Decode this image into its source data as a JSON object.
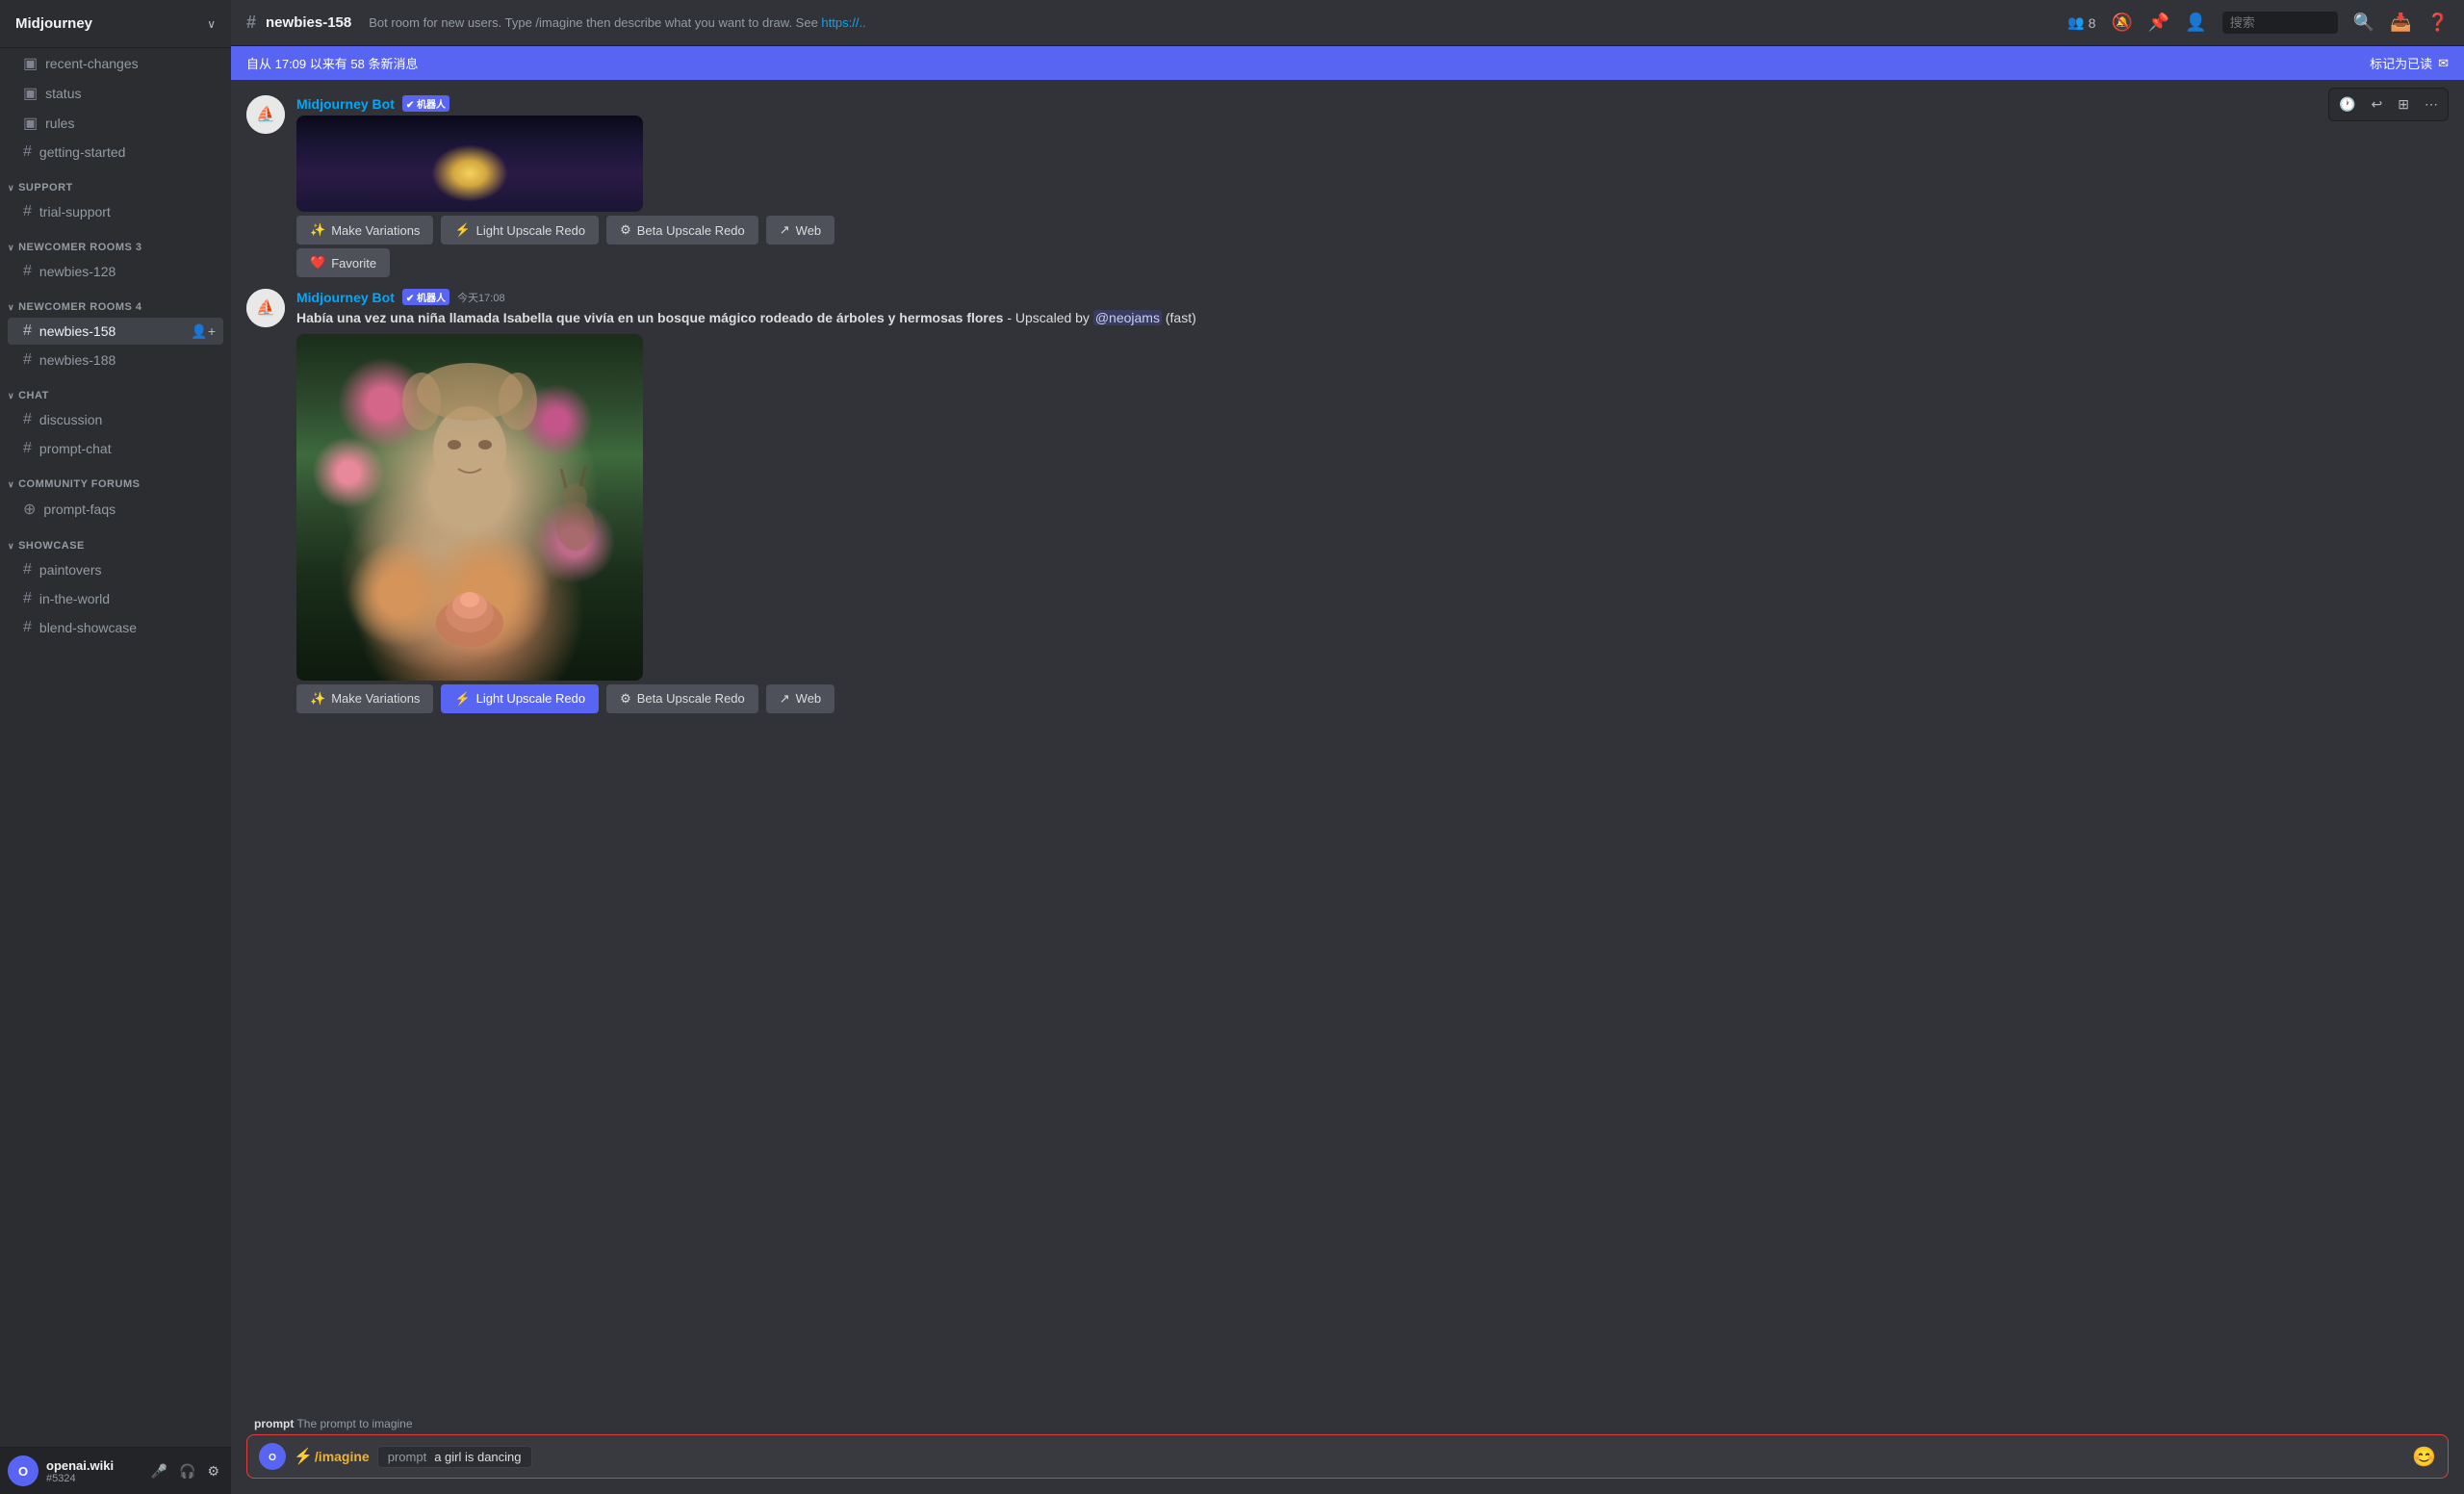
{
  "server": {
    "name": "Midjourney",
    "arrow": "∨"
  },
  "sidebar": {
    "categories": [
      {
        "name": "support",
        "label": "SUPPORT",
        "channels": [
          {
            "id": "trial-support",
            "label": "trial-support",
            "icon": "#"
          }
        ]
      },
      {
        "name": "newcomer-rooms-3",
        "label": "NEWCOMER ROOMS 3",
        "channels": [
          {
            "id": "newbies-128",
            "label": "newbies-128",
            "icon": "#"
          }
        ]
      },
      {
        "name": "newcomer-rooms-4",
        "label": "NEWCOMER ROOMS 4",
        "channels": [
          {
            "id": "newbies-158",
            "label": "newbies-158",
            "icon": "#",
            "active": true
          },
          {
            "id": "newbies-188",
            "label": "newbies-188",
            "icon": "#"
          }
        ]
      },
      {
        "name": "chat",
        "label": "CHAT",
        "channels": [
          {
            "id": "discussion",
            "label": "discussion",
            "icon": "#"
          },
          {
            "id": "prompt-chat",
            "label": "prompt-chat",
            "icon": "#"
          }
        ]
      },
      {
        "name": "community-forums",
        "label": "COMMUNITY FORUMS",
        "channels": [
          {
            "id": "prompt-faqs",
            "label": "prompt-faqs",
            "icon": "⊕"
          }
        ]
      },
      {
        "name": "showcase",
        "label": "SHOWCASE",
        "channels": [
          {
            "id": "paintovers",
            "label": "paintovers",
            "icon": "#"
          },
          {
            "id": "in-the-world",
            "label": "in-the-world",
            "icon": "#"
          },
          {
            "id": "blend-showcase",
            "label": "blend-showcase",
            "icon": "#"
          }
        ]
      }
    ],
    "top_channels": [
      {
        "id": "recent-changes",
        "label": "recent-changes",
        "icon": "▣"
      },
      {
        "id": "status",
        "label": "status",
        "icon": "▣"
      },
      {
        "id": "rules",
        "label": "rules",
        "icon": "▣"
      },
      {
        "id": "getting-started",
        "label": "getting-started",
        "icon": "#"
      }
    ]
  },
  "header": {
    "channel_name": "newbies-158",
    "channel_icon": "#",
    "description": "Bot room for new users. Type /imagine then describe what you want to draw. See",
    "description_link": "https://..",
    "member_count": "8",
    "search_placeholder": "搜索"
  },
  "notification_banner": {
    "text": "自从 17:09 以来有 58 条新消息",
    "mark_read": "标记为已读",
    "mark_read_icon": "✉"
  },
  "messages": [
    {
      "id": "msg-1",
      "author": "Midjourney Bot",
      "author_color": "#00a8fc",
      "is_bot": true,
      "bot_badge": "机器人",
      "timestamp": "今天17:08",
      "text": "Había una vez una niña llamada Isabella que vivía en un bosque mágico rodeado de árboles y hermosas flores - Upscaled by @neojams (fast)",
      "has_image": true,
      "image_type": "forest_girl",
      "buttons": [
        {
          "label": "Make Variations",
          "icon": "✨",
          "active": false
        },
        {
          "label": "Light Upscale Redo",
          "icon": "⚡",
          "active": true
        },
        {
          "label": "Beta Upscale Redo",
          "icon": "⚙",
          "active": false
        },
        {
          "label": "Web",
          "icon": "↗",
          "active": false
        }
      ]
    }
  ],
  "top_partial_message": {
    "author": "Midjourney Bot",
    "bot_badge": "机器人",
    "text": "Había una vez una niña llamada Isabella que vivía en un bosque mágico rodeado de árboles y hermosas flores - @neoj...",
    "buttons_top": [
      {
        "label": "Make Variations",
        "icon": "✨",
        "active": false
      },
      {
        "label": "Light Upscale Redo",
        "icon": "⚡",
        "active": false
      },
      {
        "label": "Beta Upscale Redo",
        "icon": "⚙",
        "active": false
      },
      {
        "label": "Web",
        "icon": "↗",
        "active": false
      }
    ],
    "favorite_btn": {
      "label": "Favorite",
      "icon": "❤️"
    }
  },
  "chat_input": {
    "hint_label": "prompt",
    "hint_text": "The prompt to imagine",
    "command": "/imagine",
    "command_icon": "⚡",
    "input_label": "prompt",
    "input_value": "a girl is dancing",
    "emoji_icon": "😊"
  },
  "user": {
    "name": "openai.wiki",
    "discriminator": "#5324",
    "avatar_color": "#5865f2"
  },
  "colors": {
    "sidebar_bg": "#2b2d31",
    "main_bg": "#313338",
    "active_channel": "#404249",
    "accent": "#5865f2",
    "active_button": "#5865f2",
    "bot_color": "#00a8fc",
    "banner_bg": "#5865f2"
  }
}
